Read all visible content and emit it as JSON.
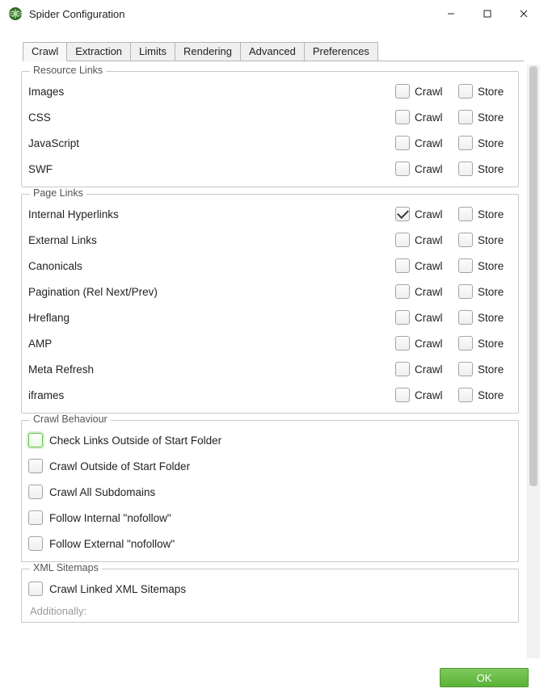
{
  "window": {
    "title": "Spider Configuration",
    "buttons": {
      "minimize": "minimize",
      "maximize": "maximize",
      "close": "close"
    }
  },
  "tabs": [
    {
      "id": "crawl",
      "label": "Crawl",
      "active": true
    },
    {
      "id": "extraction",
      "label": "Extraction",
      "active": false
    },
    {
      "id": "limits",
      "label": "Limits",
      "active": false
    },
    {
      "id": "rendering",
      "label": "Rendering",
      "active": false
    },
    {
      "id": "advanced",
      "label": "Advanced",
      "active": false
    },
    {
      "id": "preferences",
      "label": "Preferences",
      "active": false
    }
  ],
  "column_labels": {
    "crawl": "Crawl",
    "store": "Store"
  },
  "groups": {
    "resource_links": {
      "legend": "Resource Links",
      "rows": [
        {
          "label": "Images",
          "crawl": false,
          "store": false
        },
        {
          "label": "CSS",
          "crawl": false,
          "store": false
        },
        {
          "label": "JavaScript",
          "crawl": false,
          "store": false
        },
        {
          "label": "SWF",
          "crawl": false,
          "store": false
        }
      ]
    },
    "page_links": {
      "legend": "Page Links",
      "rows": [
        {
          "label": "Internal Hyperlinks",
          "crawl": true,
          "store": false
        },
        {
          "label": "External Links",
          "crawl": false,
          "store": false
        },
        {
          "label": "Canonicals",
          "crawl": false,
          "store": false
        },
        {
          "label": "Pagination (Rel Next/Prev)",
          "crawl": false,
          "store": false
        },
        {
          "label": "Hreflang",
          "crawl": false,
          "store": false
        },
        {
          "label": "AMP",
          "crawl": false,
          "store": false
        },
        {
          "label": "Meta Refresh",
          "crawl": false,
          "store": false
        },
        {
          "label": "iframes",
          "crawl": false,
          "store": false
        }
      ]
    },
    "crawl_behaviour": {
      "legend": "Crawl Behaviour",
      "rows": [
        {
          "label": "Check Links Outside of Start Folder",
          "checked": false,
          "highlight": true
        },
        {
          "label": "Crawl Outside of Start Folder",
          "checked": false
        },
        {
          "label": "Crawl All Subdomains",
          "checked": false
        },
        {
          "label": "Follow Internal \"nofollow\"",
          "checked": false
        },
        {
          "label": "Follow External \"nofollow\"",
          "checked": false
        }
      ]
    },
    "xml_sitemaps": {
      "legend": "XML Sitemaps",
      "rows": [
        {
          "label": "Crawl Linked XML Sitemaps",
          "checked": false
        }
      ],
      "subtext": "Additionally:"
    }
  },
  "footer": {
    "ok": "OK"
  }
}
